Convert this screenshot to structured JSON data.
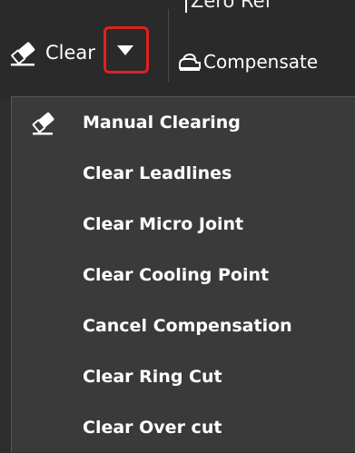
{
  "toolbar": {
    "zero_ref_label": "Zero Ref",
    "clear_label": "Clear",
    "compensate_label": "Compensate"
  },
  "menu": {
    "items": [
      {
        "label": "Manual Clearing",
        "icon": "eraser-icon"
      },
      {
        "label": "Clear Leadlines"
      },
      {
        "label": "Clear Micro Joint"
      },
      {
        "label": "Clear Cooling Point"
      },
      {
        "label": "Cancel Compensation"
      },
      {
        "label": "Clear Ring Cut"
      },
      {
        "label": "Clear Over cut"
      }
    ]
  },
  "colors": {
    "toolbar_bg": "#2a2a2a",
    "menu_bg": "#3a3a3a",
    "highlight_border": "#e02020",
    "text": "#ffffff"
  }
}
